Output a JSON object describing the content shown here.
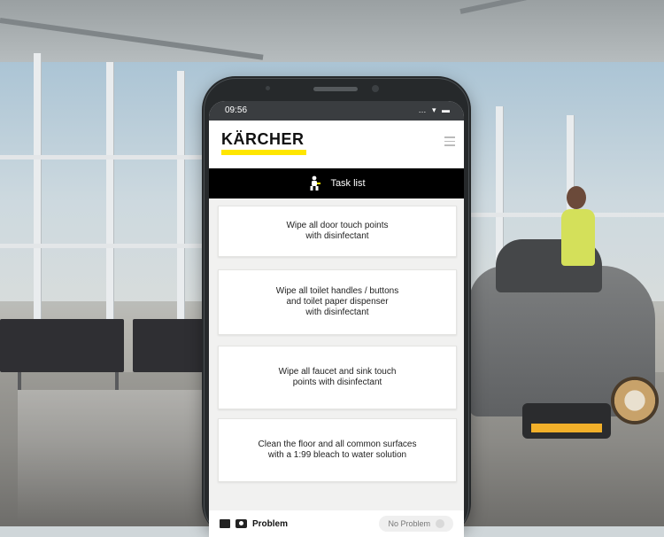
{
  "status_bar": {
    "time": "09:56",
    "icons": "… ▾ ▬"
  },
  "app": {
    "brand": "KÄRCHER",
    "brand_color": "#ffe600"
  },
  "task_header": {
    "title": "Task list"
  },
  "tasks": [
    {
      "text": "Wipe all door touch points\nwith disinfectant"
    },
    {
      "text": "Wipe all toilet handles / buttons\nand toilet paper dispenser\nwith disinfectant"
    },
    {
      "text": "Wipe all faucet and sink touch\npoints with disinfectant"
    },
    {
      "text": "Clean the floor and all common surfaces\nwith a 1:99 bleach to water solution"
    }
  ],
  "bottom_bar": {
    "problem_label": "Problem",
    "no_problem_label": "No Problem"
  }
}
